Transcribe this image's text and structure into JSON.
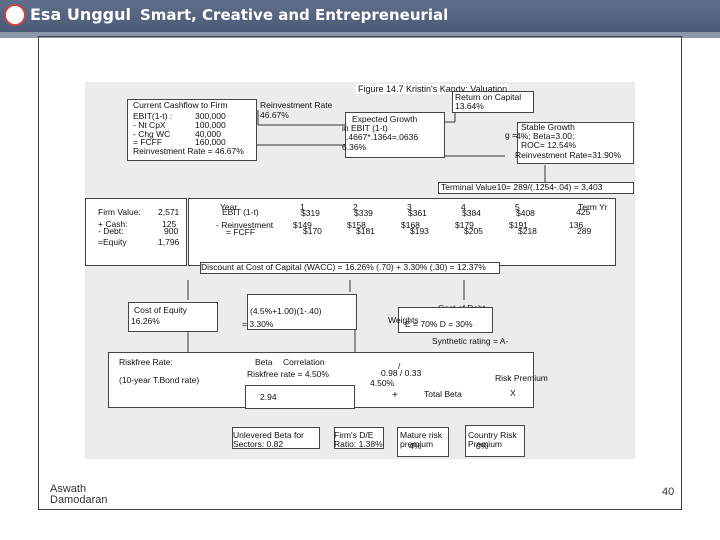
{
  "header": {
    "logo": "Esa Unggul",
    "tagline": "Smart, Creative and Entrepreneurial"
  },
  "diagram": {
    "title": "Figure 14.7 Kristin's Kandy: Valuation",
    "current_cashflow": {
      "title": "Current Cashflow to Firm",
      "rows": [
        {
          "label": "EBIT(1-t) :",
          "value": "300,000"
        },
        {
          "label": "- Nt CpX",
          "value": "100,000"
        },
        {
          "label": "- Chg WC",
          "value": "40,000"
        },
        {
          "label": "= FCFF",
          "value": "160,000"
        }
      ],
      "reinvestment": "Reinvestment Rate = 46.67%"
    },
    "reinvestment_rate": {
      "label": "Reinvestment Rate",
      "value": "46.67%"
    },
    "return_on_capital": {
      "label": "Return on Capital",
      "value": "13.64%"
    },
    "expected_growth": {
      "title": "Expected Growth",
      "line1": "in EBIT (1-t)",
      "line2": ".4667*.1364=.0636",
      "line3": "6.36%"
    },
    "stable_growth": {
      "title": "Stable Growth",
      "prefix": "g =",
      "line1": "4%; Beta=3.00;",
      "line2": "ROC= 12.54%",
      "line3": "Reinvestment Rate=31.90%"
    },
    "terminal_value": "Terminal Value10= 289/(.1254-.04) = 3,403",
    "firm_value": {
      "rows": [
        {
          "label": "Firm Value:",
          "value": "2,571"
        },
        {
          "label": "+ Cash:",
          "value": "125"
        },
        {
          "label": "- Debt:",
          "value": "900"
        },
        {
          "label": "=Equity",
          "value": "1,796"
        }
      ]
    },
    "cashflows": {
      "year_label": "Year",
      "ebit_label": "EBIT (1-t)",
      "reinv_label": "- Reinvestment",
      "fcff_label": "= FCFF",
      "years": [
        "1",
        "2",
        "3",
        "4",
        "5"
      ],
      "ebit": [
        "$319",
        "$339",
        "$361",
        "$384",
        "$408"
      ],
      "reinv": [
        "$149",
        "$158",
        "$168",
        "$179",
        "$191"
      ],
      "fcff": [
        "$170",
        "$181",
        "$193",
        "$205",
        "$218"
      ],
      "term_label": "Term Yr",
      "term_ebit": "425",
      "term_reinv": "136",
      "term_fcff": "289"
    },
    "discount": "Discount at Cost of Capital (WACC) = 16.26% (.70) + 3.30% (.30) = 12.37%",
    "cost_of_equity": {
      "label": "Cost of Equity",
      "value": "16.26%"
    },
    "cost_of_debt": {
      "formula": "(4.5%+1.00)(1-.40)",
      "value": "= 3.30%",
      "label": "Cost of Debt"
    },
    "weights": {
      "label": "Weights",
      "value": "E = 70% D = 30%"
    },
    "synthetic_rating": "Synthetic rating = A-",
    "riskfree": {
      "label": "Riskfree Rate:",
      "sub": "(10-year T.Bond rate)",
      "value": "4.50%"
    },
    "beta_block": {
      "beta": "Beta",
      "correlation": "Correlation",
      "riskfree_line": "Riskfree rate = 4.50%",
      "plus": "+",
      "beta_value": "2.94",
      "ratio": "0.98 / 0.33",
      "slash": "/"
    },
    "total_beta": "Total Beta",
    "times": "X",
    "risk_premium": "Risk Premium",
    "bottom_boxes": [
      {
        "line1": "Unlevered Beta for",
        "line2": "Sectors: 0.82"
      },
      {
        "line1": "Firm's D/E",
        "line2": "Ratio: 1.38%"
      },
      {
        "line1": "Mature risk",
        "line2": "premium",
        "line3": "4%"
      },
      {
        "line1": "Country Risk",
        "line2": "Premium",
        "line3": "0%"
      }
    ]
  },
  "footer": {
    "author_first": "Aswath",
    "author_last": "Damodaran",
    "page": "40"
  }
}
